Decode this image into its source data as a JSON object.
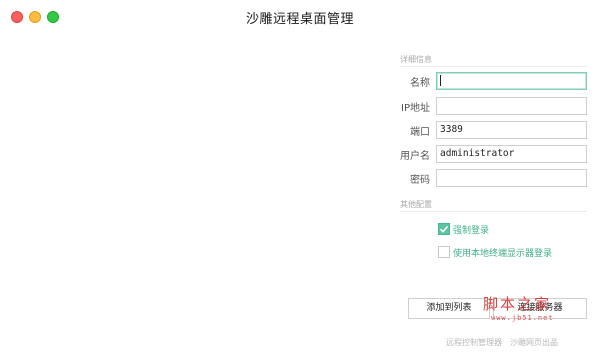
{
  "window": {
    "title": "沙雕远程桌面管理"
  },
  "sections": {
    "details": "详细信息",
    "other": "其他配置"
  },
  "fields": [
    {
      "label": "名称",
      "value": ""
    },
    {
      "label": "IP地址",
      "value": ""
    },
    {
      "label": "端口",
      "value": "3389"
    },
    {
      "label": "用户名",
      "value": "administrator"
    },
    {
      "label": "密码",
      "value": ""
    }
  ],
  "options": [
    {
      "label": "强制登录",
      "checked": true
    },
    {
      "label": "使用本地终端显示器登录",
      "checked": false
    }
  ],
  "buttons": {
    "add_to_list": "添加到列表",
    "connect": "连接服务器"
  },
  "footer": {
    "left_link": "远程控制管理器",
    "right_link": "沙雕网页出品"
  },
  "watermark": {
    "main": "脚本之家",
    "sub": "www.jb51.net"
  },
  "colors": {
    "accent": "#5cc4a0",
    "focus_border": "#7fcfb0",
    "watermark": "#d63030"
  }
}
